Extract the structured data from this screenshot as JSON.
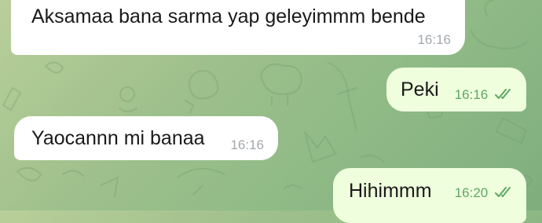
{
  "chat": {
    "messages": [
      {
        "direction": "incoming",
        "text": "Aksamaa bana sarma yap geleyimmm bende",
        "time": "16:16"
      },
      {
        "direction": "outgoing",
        "text": "Peki",
        "time": "16:16",
        "status": "read"
      },
      {
        "direction": "incoming",
        "text": "Yaocannn mi banaa",
        "time": "16:16"
      },
      {
        "direction": "outgoing",
        "text": "Hihimmm",
        "time": "16:20",
        "status": "read"
      }
    ]
  },
  "theme": {
    "incoming_bubble": "#ffffff",
    "outgoing_bubble": "#effedd",
    "read_tick_color": "#5da865",
    "wallpaper": "#9fc08c"
  }
}
